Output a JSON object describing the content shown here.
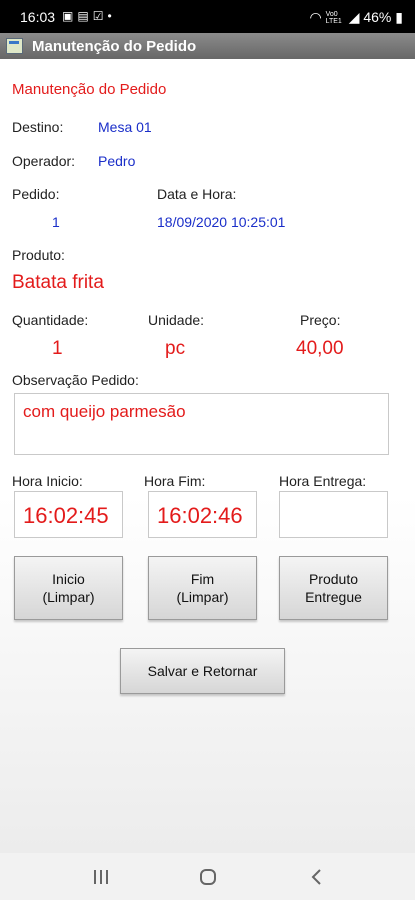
{
  "status_bar": {
    "time": "16:03",
    "battery": "46%",
    "net_top": "Vo0",
    "net_bottom": "LTE1"
  },
  "window": {
    "title": "Manutenção do Pedido"
  },
  "header": {
    "title": "Manutenção do Pedido"
  },
  "destino": {
    "label": "Destino:",
    "value": "Mesa 01"
  },
  "operador": {
    "label": "Operador:",
    "value": "Pedro"
  },
  "pedido": {
    "label": "Pedido:",
    "value": "1"
  },
  "data_hora": {
    "label": "Data e Hora:",
    "value": "18/09/2020 10:25:01"
  },
  "produto": {
    "label": "Produto:",
    "value": "Batata frita"
  },
  "quantidade": {
    "label": "Quantidade:",
    "value": "1"
  },
  "unidade": {
    "label": "Unidade:",
    "value": "pc"
  },
  "preco": {
    "label": "Preço:",
    "value": "40,00"
  },
  "observacao": {
    "label": "Observação Pedido:",
    "value": "com queijo parmesão"
  },
  "hora_inicio": {
    "label": "Hora Inicio:",
    "value": "16:02:45"
  },
  "hora_fim": {
    "label": "Hora Fim:",
    "value": "16:02:46"
  },
  "hora_entrega": {
    "label": "Hora Entrega:",
    "value": ""
  },
  "buttons": {
    "inicio": "Inicio\n(Limpar)",
    "fim": "Fim\n(Limpar)",
    "produto_entregue": "Produto\nEntregue",
    "salvar": "Salvar e Retornar"
  },
  "colors": {
    "accent_red": "#e31b1b",
    "accent_blue": "#1a2ec9",
    "title_bar": "#777777"
  }
}
